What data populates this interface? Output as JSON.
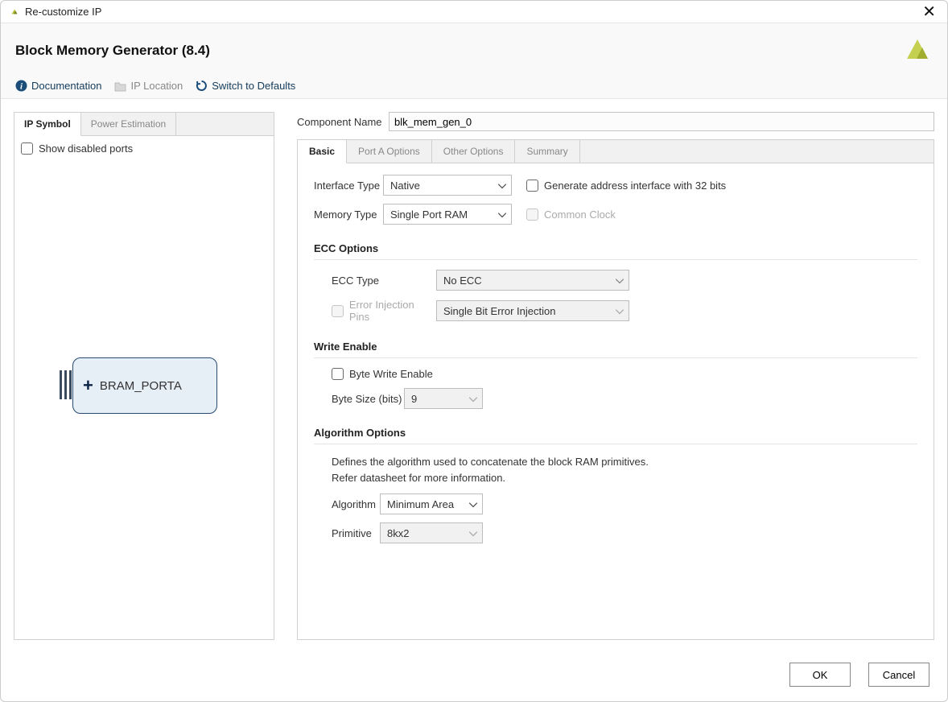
{
  "titlebar": {
    "title": "Re-customize IP"
  },
  "header": {
    "page_title": "Block Memory Generator (8.4)",
    "toolbar": {
      "documentation": "Documentation",
      "ip_location": "IP Location",
      "switch_defaults": "Switch to Defaults"
    }
  },
  "left_panel": {
    "tabs": {
      "symbol": "IP Symbol",
      "power": "Power Estimation"
    },
    "show_disabled": "Show disabled ports",
    "bram_port": "BRAM_PORTA"
  },
  "component_name": {
    "label": "Component Name",
    "value": "blk_mem_gen_0"
  },
  "main_tabs": {
    "basic": "Basic",
    "porta": "Port A Options",
    "other": "Other Options",
    "summary": "Summary"
  },
  "basic": {
    "interface_type": {
      "label": "Interface Type",
      "value": "Native"
    },
    "memory_type": {
      "label": "Memory Type",
      "value": "Single Port RAM"
    },
    "gen32": "Generate address interface with 32 bits",
    "common_clock": "Common Clock",
    "ecc": {
      "title": "ECC Options",
      "ecc_type": {
        "label": "ECC Type",
        "value": "No ECC"
      },
      "error_inj_pins": "Error Injection Pins",
      "error_inj_value": "Single Bit Error Injection"
    },
    "write_enable": {
      "title": "Write Enable",
      "byte_write": "Byte Write Enable",
      "byte_size": {
        "label": "Byte Size (bits)",
        "value": "9"
      }
    },
    "algorithm": {
      "title": "Algorithm Options",
      "desc1": "Defines the algorithm used to concatenate the block RAM primitives.",
      "desc2": "Refer datasheet for more information.",
      "algo": {
        "label": "Algorithm",
        "value": "Minimum Area"
      },
      "primitive": {
        "label": "Primitive",
        "value": "8kx2"
      }
    }
  },
  "footer": {
    "ok": "OK",
    "cancel": "Cancel"
  }
}
